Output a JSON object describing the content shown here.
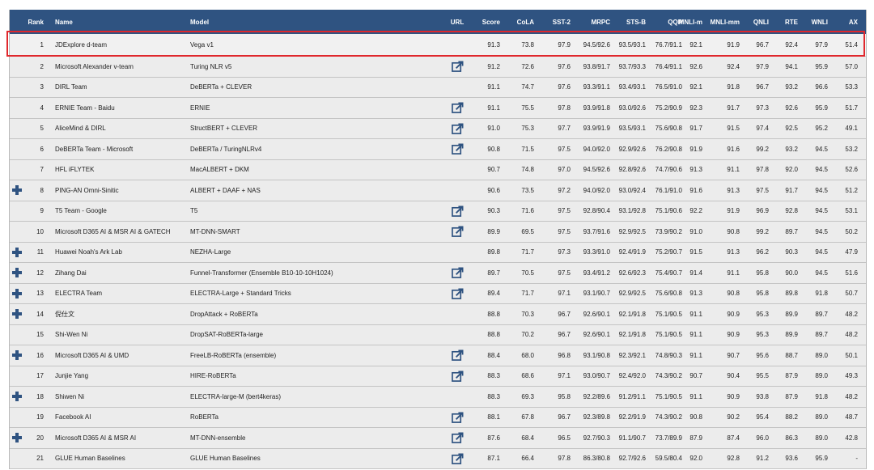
{
  "headers": [
    "Rank",
    "Name",
    "Model",
    "URL",
    "Score",
    "CoLA",
    "SST-2",
    "MRPC",
    "STS-B",
    "QQP",
    "MNLI-m",
    "MNLI-mm",
    "QNLI",
    "RTE",
    "WNLI",
    "AX"
  ],
  "colors": {
    "header_bg": "#2f5381",
    "plus": "#2f5381",
    "highlight": "#e0282d"
  },
  "rows": [
    {
      "rank": "1",
      "name": "JDExplore d-team",
      "model": "Vega v1",
      "url": false,
      "plus": false,
      "score": "91.3",
      "cola": "73.8",
      "sst2": "97.9",
      "mrpc": "94.5/92.6",
      "stsb": "93.5/93.1",
      "qqp": "76.7/91.1",
      "mnlim": "92.1",
      "mnlimm": "91.9",
      "qnli": "96.7",
      "rte": "92.4",
      "wnli": "97.9",
      "ax": "51.4"
    },
    {
      "rank": "2",
      "name": "Microsoft Alexander v-team",
      "model": "Turing NLR v5",
      "url": true,
      "plus": false,
      "score": "91.2",
      "cola": "72.6",
      "sst2": "97.6",
      "mrpc": "93.8/91.7",
      "stsb": "93.7/93.3",
      "qqp": "76.4/91.1",
      "mnlim": "92.6",
      "mnlimm": "92.4",
      "qnli": "97.9",
      "rte": "94.1",
      "wnli": "95.9",
      "ax": "57.0"
    },
    {
      "rank": "3",
      "name": "DIRL Team",
      "model": "DeBERTa + CLEVER",
      "url": false,
      "plus": false,
      "score": "91.1",
      "cola": "74.7",
      "sst2": "97.6",
      "mrpc": "93.3/91.1",
      "stsb": "93.4/93.1",
      "qqp": "76.5/91.0",
      "mnlim": "92.1",
      "mnlimm": "91.8",
      "qnli": "96.7",
      "rte": "93.2",
      "wnli": "96.6",
      "ax": "53.3"
    },
    {
      "rank": "4",
      "name": "ERNIE Team - Baidu",
      "model": "ERNIE",
      "url": true,
      "plus": false,
      "score": "91.1",
      "cola": "75.5",
      "sst2": "97.8",
      "mrpc": "93.9/91.8",
      "stsb": "93.0/92.6",
      "qqp": "75.2/90.9",
      "mnlim": "92.3",
      "mnlimm": "91.7",
      "qnli": "97.3",
      "rte": "92.6",
      "wnli": "95.9",
      "ax": "51.7"
    },
    {
      "rank": "5",
      "name": "AliceMind & DIRL",
      "model": "StructBERT + CLEVER",
      "url": true,
      "plus": false,
      "score": "91.0",
      "cola": "75.3",
      "sst2": "97.7",
      "mrpc": "93.9/91.9",
      "stsb": "93.5/93.1",
      "qqp": "75.6/90.8",
      "mnlim": "91.7",
      "mnlimm": "91.5",
      "qnli": "97.4",
      "rte": "92.5",
      "wnli": "95.2",
      "ax": "49.1"
    },
    {
      "rank": "6",
      "name": "DeBERTa Team - Microsoft",
      "model": "DeBERTa / TuringNLRv4",
      "url": true,
      "plus": false,
      "score": "90.8",
      "cola": "71.5",
      "sst2": "97.5",
      "mrpc": "94.0/92.0",
      "stsb": "92.9/92.6",
      "qqp": "76.2/90.8",
      "mnlim": "91.9",
      "mnlimm": "91.6",
      "qnli": "99.2",
      "rte": "93.2",
      "wnli": "94.5",
      "ax": "53.2"
    },
    {
      "rank": "7",
      "name": "HFL iFLYTEK",
      "model": "MacALBERT + DKM",
      "url": false,
      "plus": false,
      "score": "90.7",
      "cola": "74.8",
      "sst2": "97.0",
      "mrpc": "94.5/92.6",
      "stsb": "92.8/92.6",
      "qqp": "74.7/90.6",
      "mnlim": "91.3",
      "mnlimm": "91.1",
      "qnli": "97.8",
      "rte": "92.0",
      "wnli": "94.5",
      "ax": "52.6"
    },
    {
      "rank": "8",
      "name": "PING-AN Omni-Sinitic",
      "model": "ALBERT + DAAF + NAS",
      "url": false,
      "plus": true,
      "score": "90.6",
      "cola": "73.5",
      "sst2": "97.2",
      "mrpc": "94.0/92.0",
      "stsb": "93.0/92.4",
      "qqp": "76.1/91.0",
      "mnlim": "91.6",
      "mnlimm": "91.3",
      "qnli": "97.5",
      "rte": "91.7",
      "wnli": "94.5",
      "ax": "51.2"
    },
    {
      "rank": "9",
      "name": "T5 Team - Google",
      "model": "T5",
      "url": true,
      "plus": false,
      "score": "90.3",
      "cola": "71.6",
      "sst2": "97.5",
      "mrpc": "92.8/90.4",
      "stsb": "93.1/92.8",
      "qqp": "75.1/90.6",
      "mnlim": "92.2",
      "mnlimm": "91.9",
      "qnli": "96.9",
      "rte": "92.8",
      "wnli": "94.5",
      "ax": "53.1"
    },
    {
      "rank": "10",
      "name": "Microsoft D365 AI & MSR AI & GATECH",
      "model": "MT-DNN-SMART",
      "url": true,
      "plus": false,
      "score": "89.9",
      "cola": "69.5",
      "sst2": "97.5",
      "mrpc": "93.7/91.6",
      "stsb": "92.9/92.5",
      "qqp": "73.9/90.2",
      "mnlim": "91.0",
      "mnlimm": "90.8",
      "qnli": "99.2",
      "rte": "89.7",
      "wnli": "94.5",
      "ax": "50.2"
    },
    {
      "rank": "11",
      "name": "Huawei Noah's Ark Lab",
      "model": "NEZHA-Large",
      "url": false,
      "plus": true,
      "score": "89.8",
      "cola": "71.7",
      "sst2": "97.3",
      "mrpc": "93.3/91.0",
      "stsb": "92.4/91.9",
      "qqp": "75.2/90.7",
      "mnlim": "91.5",
      "mnlimm": "91.3",
      "qnli": "96.2",
      "rte": "90.3",
      "wnli": "94.5",
      "ax": "47.9"
    },
    {
      "rank": "12",
      "name": "Zihang Dai",
      "model": "Funnel-Transformer (Ensemble B10-10-10H1024)",
      "url": true,
      "plus": true,
      "score": "89.7",
      "cola": "70.5",
      "sst2": "97.5",
      "mrpc": "93.4/91.2",
      "stsb": "92.6/92.3",
      "qqp": "75.4/90.7",
      "mnlim": "91.4",
      "mnlimm": "91.1",
      "qnli": "95.8",
      "rte": "90.0",
      "wnli": "94.5",
      "ax": "51.6"
    },
    {
      "rank": "13",
      "name": "ELECTRA Team",
      "model": "ELECTRA-Large + Standard Tricks",
      "url": true,
      "plus": true,
      "score": "89.4",
      "cola": "71.7",
      "sst2": "97.1",
      "mrpc": "93.1/90.7",
      "stsb": "92.9/92.5",
      "qqp": "75.6/90.8",
      "mnlim": "91.3",
      "mnlimm": "90.8",
      "qnli": "95.8",
      "rte": "89.8",
      "wnli": "91.8",
      "ax": "50.7"
    },
    {
      "rank": "14",
      "name": "倪仕文",
      "model": "DropAttack + RoBERTa",
      "url": false,
      "plus": true,
      "score": "88.8",
      "cola": "70.3",
      "sst2": "96.7",
      "mrpc": "92.6/90.1",
      "stsb": "92.1/91.8",
      "qqp": "75.1/90.5",
      "mnlim": "91.1",
      "mnlimm": "90.9",
      "qnli": "95.3",
      "rte": "89.9",
      "wnli": "89.7",
      "ax": "48.2"
    },
    {
      "rank": "15",
      "name": "Shi-Wen Ni",
      "model": "DropSAT-RoBERTa-large",
      "url": false,
      "plus": false,
      "score": "88.8",
      "cola": "70.2",
      "sst2": "96.7",
      "mrpc": "92.6/90.1",
      "stsb": "92.1/91.8",
      "qqp": "75.1/90.5",
      "mnlim": "91.1",
      "mnlimm": "90.9",
      "qnli": "95.3",
      "rte": "89.9",
      "wnli": "89.7",
      "ax": "48.2"
    },
    {
      "rank": "16",
      "name": "Microsoft D365 AI & UMD",
      "model": "FreeLB-RoBERTa (ensemble)",
      "url": true,
      "plus": true,
      "score": "88.4",
      "cola": "68.0",
      "sst2": "96.8",
      "mrpc": "93.1/90.8",
      "stsb": "92.3/92.1",
      "qqp": "74.8/90.3",
      "mnlim": "91.1",
      "mnlimm": "90.7",
      "qnli": "95.6",
      "rte": "88.7",
      "wnli": "89.0",
      "ax": "50.1"
    },
    {
      "rank": "17",
      "name": "Junjie Yang",
      "model": "HIRE-RoBERTa",
      "url": true,
      "plus": false,
      "score": "88.3",
      "cola": "68.6",
      "sst2": "97.1",
      "mrpc": "93.0/90.7",
      "stsb": "92.4/92.0",
      "qqp": "74.3/90.2",
      "mnlim": "90.7",
      "mnlimm": "90.4",
      "qnli": "95.5",
      "rte": "87.9",
      "wnli": "89.0",
      "ax": "49.3"
    },
    {
      "rank": "18",
      "name": "Shiwen Ni",
      "model": "ELECTRA-large-M (bert4keras)",
      "url": false,
      "plus": true,
      "score": "88.3",
      "cola": "69.3",
      "sst2": "95.8",
      "mrpc": "92.2/89.6",
      "stsb": "91.2/91.1",
      "qqp": "75.1/90.5",
      "mnlim": "91.1",
      "mnlimm": "90.9",
      "qnli": "93.8",
      "rte": "87.9",
      "wnli": "91.8",
      "ax": "48.2"
    },
    {
      "rank": "19",
      "name": "Facebook AI",
      "model": "RoBERTa",
      "url": true,
      "plus": false,
      "score": "88.1",
      "cola": "67.8",
      "sst2": "96.7",
      "mrpc": "92.3/89.8",
      "stsb": "92.2/91.9",
      "qqp": "74.3/90.2",
      "mnlim": "90.8",
      "mnlimm": "90.2",
      "qnli": "95.4",
      "rte": "88.2",
      "wnli": "89.0",
      "ax": "48.7"
    },
    {
      "rank": "20",
      "name": "Microsoft D365 AI & MSR AI",
      "model": "MT-DNN-ensemble",
      "url": true,
      "plus": true,
      "score": "87.6",
      "cola": "68.4",
      "sst2": "96.5",
      "mrpc": "92.7/90.3",
      "stsb": "91.1/90.7",
      "qqp": "73.7/89.9",
      "mnlim": "87.9",
      "mnlimm": "87.4",
      "qnli": "96.0",
      "rte": "86.3",
      "wnli": "89.0",
      "ax": "42.8"
    },
    {
      "rank": "21",
      "name": "GLUE Human Baselines",
      "model": "GLUE Human Baselines",
      "url": true,
      "plus": false,
      "score": "87.1",
      "cola": "66.4",
      "sst2": "97.8",
      "mrpc": "86.3/80.8",
      "stsb": "92.7/92.6",
      "qqp": "59.5/80.4",
      "mnlim": "92.0",
      "mnlimm": "92.8",
      "qnli": "91.2",
      "rte": "93.6",
      "wnli": "95.9",
      "ax": "-"
    }
  ]
}
